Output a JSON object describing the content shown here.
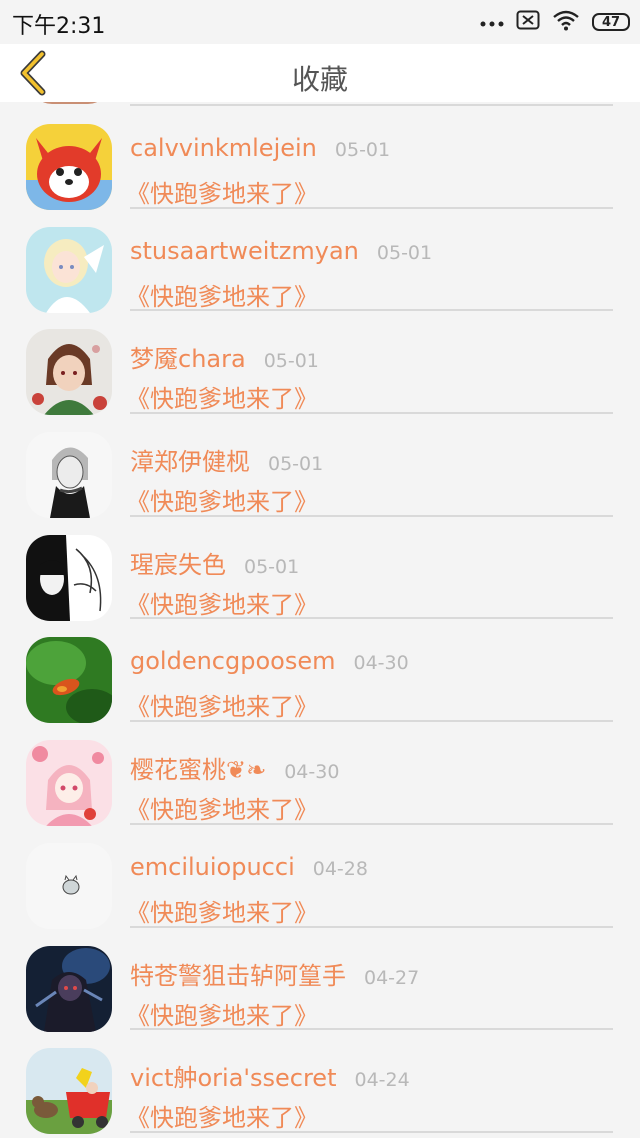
{
  "status_bar": {
    "time": "下午2:31",
    "battery": "47"
  },
  "header": {
    "title": "收藏"
  },
  "colors": {
    "accent": "#f08a57",
    "date": "#b8b8b8",
    "back": "#f2c12e"
  },
  "favorites": [
    {
      "name": "calvvinkmlejein",
      "date": "05-01",
      "book": "《快跑爹地来了》"
    },
    {
      "name": "stusaartweitzmyan",
      "date": "05-01",
      "book": "《快跑爹地来了》"
    },
    {
      "name": "梦魇chara",
      "date": "05-01",
      "book": "《快跑爹地来了》"
    },
    {
      "name": "漳郑伊健枧",
      "date": "05-01",
      "book": "《快跑爹地来了》"
    },
    {
      "name": "瑆宸失色",
      "date": "05-01",
      "book": "《快跑爹地来了》"
    },
    {
      "name": "goldencgpoosem",
      "date": "04-30",
      "book": "《快跑爹地来了》"
    },
    {
      "name": "樱花蜜桃❦❧",
      "date": "04-30",
      "book": "《快跑爹地来了》"
    },
    {
      "name": "emciluiopucci",
      "date": "04-28",
      "book": "《快跑爹地来了》"
    },
    {
      "name": "特苍警狙击轳阿篁手",
      "date": "04-27",
      "book": "《快跑爹地来了》"
    },
    {
      "name": "vict舯oria'ssecret",
      "date": "04-24",
      "book": "《快跑爹地来了》"
    }
  ]
}
